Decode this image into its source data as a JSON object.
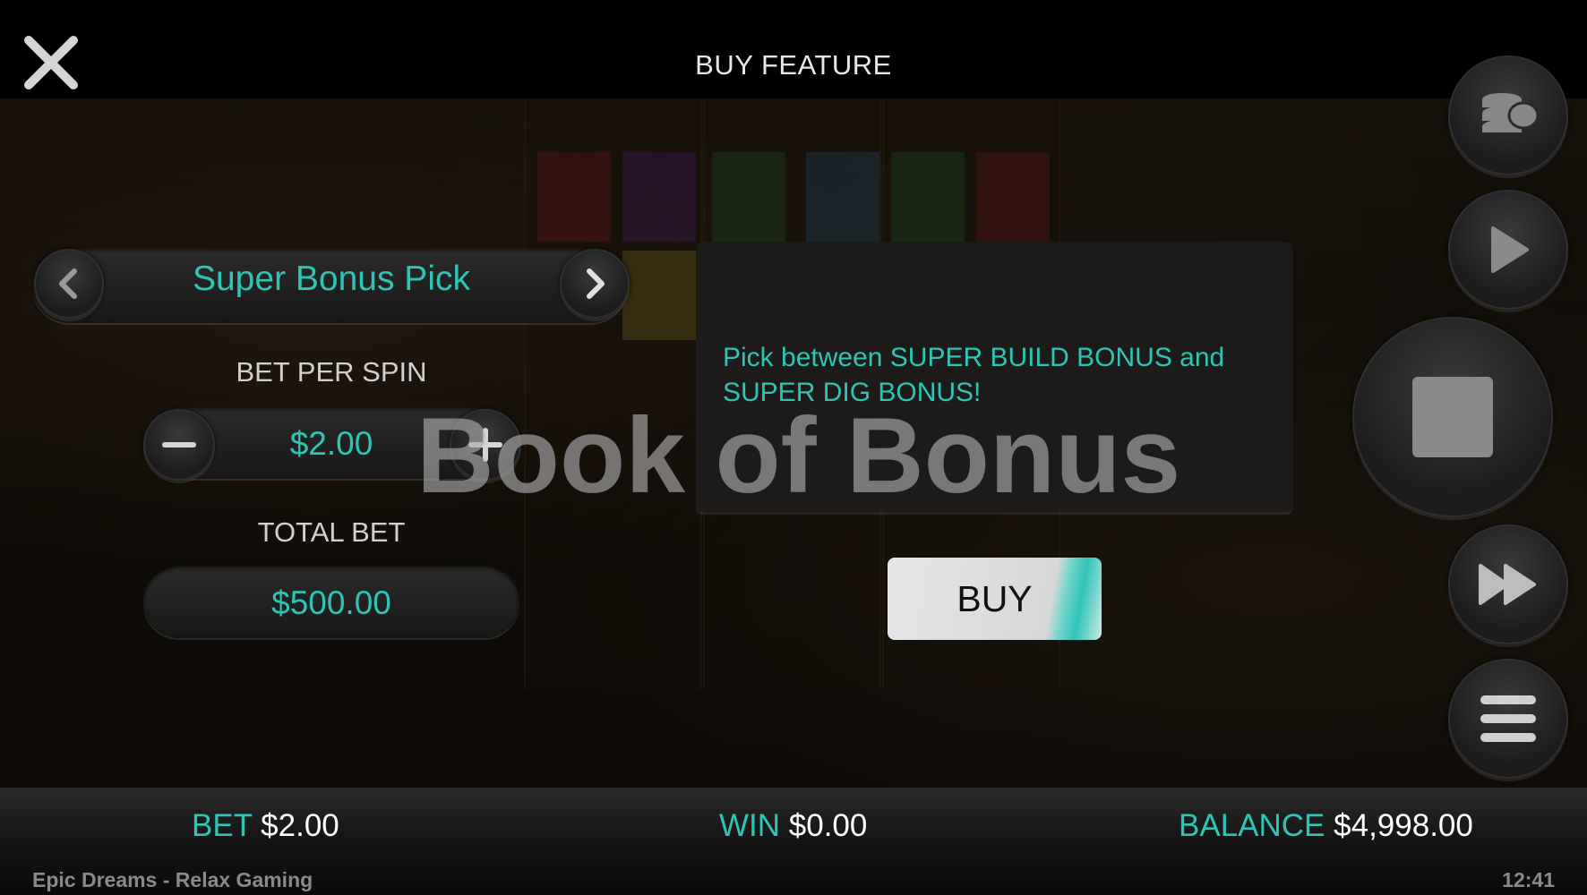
{
  "header": {
    "title": "BUY FEATURE"
  },
  "feature": {
    "name": "Super Bonus Pick"
  },
  "bet_per_spin": {
    "label": "BET PER SPIN",
    "value": "$2.00"
  },
  "total_bet": {
    "label": "TOTAL BET",
    "value": "$500.00"
  },
  "description": "Pick between SUPER BUILD BONUS and SUPER DIG BONUS!",
  "watermark": "Book of Bonus",
  "buy_button": {
    "label": "BUY"
  },
  "status_bar": {
    "bet_label": "BET",
    "bet_value": "$2.00",
    "win_label": "WIN",
    "win_value": "$0.00",
    "balance_label": "BALANCE",
    "balance_value": "$4,998.00"
  },
  "footer": {
    "app": "Epic Dreams - Relax Gaming",
    "time": "12:41"
  },
  "colors": {
    "accent": "#2ec4b6",
    "background": "#000000"
  }
}
